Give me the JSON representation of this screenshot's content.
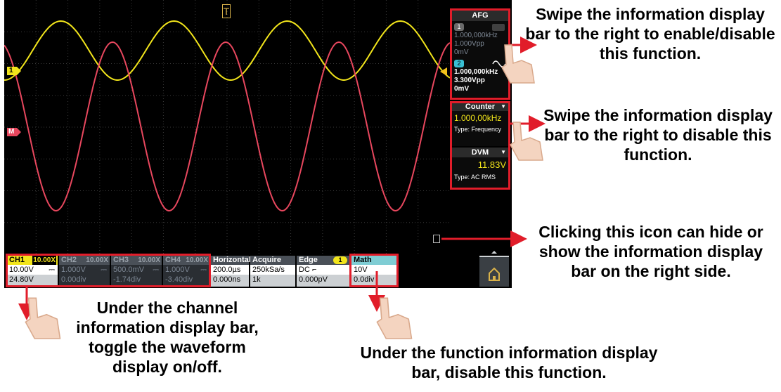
{
  "trigger_marker": "T",
  "markers": {
    "ch1": "1",
    "math": "M",
    "trigger_level": ""
  },
  "afg": {
    "title": "AFG",
    "ch1": {
      "num": "1",
      "freq": "1.000,000kHz",
      "amp": "1.000Vpp",
      "offset": "0mV"
    },
    "ch2": {
      "num": "2",
      "freq": "1.000,000kHz",
      "amp": "3.300Vpp",
      "offset": "0mV"
    }
  },
  "counter": {
    "title": "Counter",
    "value": "1.000,00kHz",
    "type": "Type: Frequency"
  },
  "dvm": {
    "title": "DVM",
    "value": "11.83V",
    "type": "Type: AC RMS"
  },
  "channels": [
    {
      "name": "CH1",
      "probe": "10.00X",
      "scale": "10.00V",
      "offset": "24.80V",
      "coupling": "⎓"
    },
    {
      "name": "CH2",
      "probe": "10.00X",
      "scale": "1.000V",
      "offset": "0.00div",
      "coupling": "⎓"
    },
    {
      "name": "CH3",
      "probe": "10.00X",
      "scale": "500.0mV",
      "offset": "-1.74div",
      "coupling": "⎓"
    },
    {
      "name": "CH4",
      "probe": "10.00X",
      "scale": "1.000V",
      "offset": "-3.40div",
      "coupling": "⎓"
    }
  ],
  "horizontal": {
    "title": "Horizontal",
    "timebase": "200.0µs",
    "delay": "0.000ns"
  },
  "acquire": {
    "title": "Acquire",
    "rate": "250kSa/s",
    "depth": "1k"
  },
  "trigger": {
    "title": "Edge",
    "source": "1",
    "coupling": "DC",
    "slope": "⌐",
    "level": "0.000pV"
  },
  "math": {
    "title": "Math",
    "scale": "10V",
    "offset": "0.0div"
  },
  "colors": {
    "ch1": "#f2e51b",
    "ch2": "#39c0d4",
    "math": "#e8475e",
    "highlight": "#e11d2a"
  },
  "icons": [
    "home-icon",
    "chevron-up-icon",
    "sine-wave-icon",
    "hand-pointer-icon",
    "arrow-icon"
  ],
  "callouts": {
    "afg": "Swipe the information display bar to the right to enable/disable this function.",
    "counter": "Swipe the information display bar to the right to disable this function.",
    "toggle": "Clicking this icon can hide or show the information display bar on the right side.",
    "channel": "Under the channel information display bar, toggle the waveform display on/off.",
    "math": "Under the function information display bar, disable this function."
  }
}
